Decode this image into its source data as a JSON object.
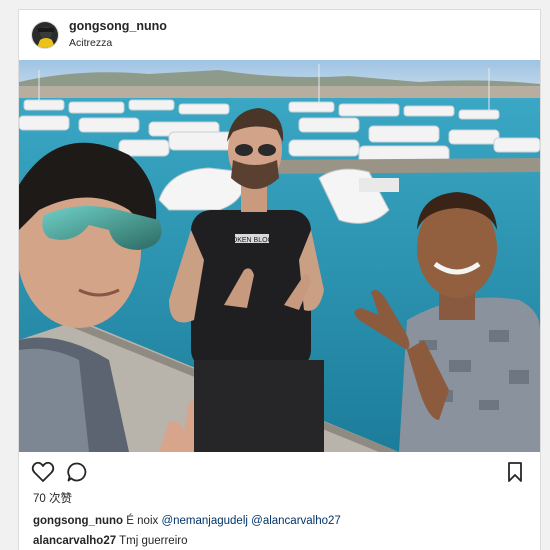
{
  "post": {
    "username": "gongsong_nuno",
    "location": "Acitrezza",
    "likes_text": "70 次赞",
    "caption": {
      "username": "gongsong_nuno",
      "text": "É noix",
      "mention1": "@nemanjagudelj",
      "mention2": "@alancarvalho27"
    },
    "comments": [
      {
        "username": "alancarvalho27",
        "text": "Tmj guerreiro"
      }
    ]
  },
  "photo": {
    "description_icon": "photo-image",
    "shirt_text": "BROKEN BLOCKS"
  },
  "actions": {
    "like_icon": "heart-icon",
    "comment_icon": "speech-bubble-icon",
    "save_icon": "bookmark-icon"
  },
  "colors": {
    "mention": "#003569",
    "text": "#262626",
    "border": "#dbdbdb"
  }
}
